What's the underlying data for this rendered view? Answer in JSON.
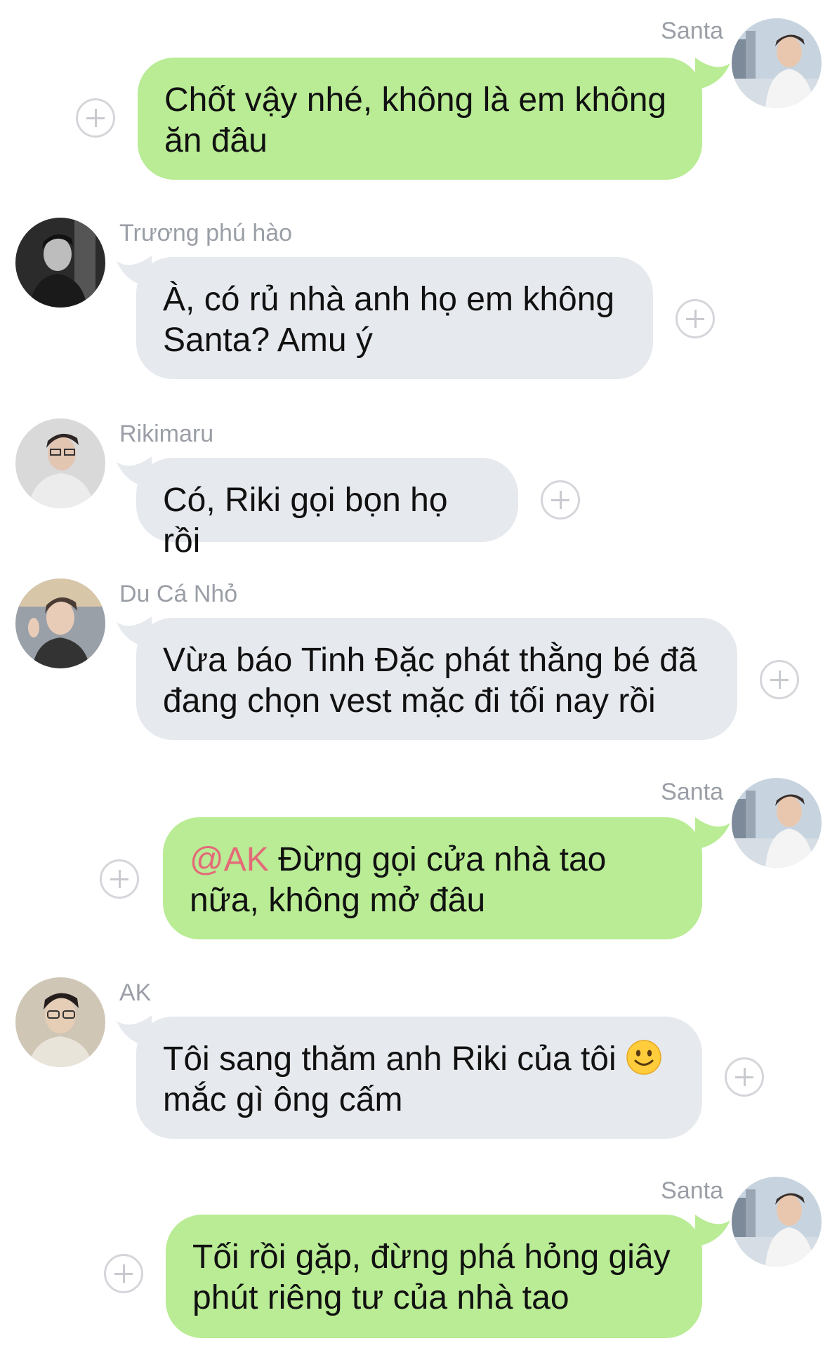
{
  "messages": [
    {
      "sender": "Santa",
      "text": "Chốt vậy nhé, không là em không ăn đâu"
    },
    {
      "sender": "Trương phú hào",
      "text": "À, có rủ nhà anh họ em không Santa? Amu ý"
    },
    {
      "sender": "Rikimaru",
      "text": "Có, Riki gọi bọn họ rồi"
    },
    {
      "sender": "Du Cá Nhỏ",
      "text": "Vừa báo Tinh Đặc phát thằng bé đã đang chọn vest mặc đi tối nay rồi"
    },
    {
      "sender": "Santa",
      "mention": "@AK",
      "text": " Đừng gọi cửa nhà tao nữa, không mở đâu"
    },
    {
      "sender": "AK",
      "text": "Tôi sang thăm anh Riki của tôi ",
      "text2": "mắc gì ông cấm",
      "emoji": "slightly-smiling-face-icon"
    },
    {
      "sender": "Santa",
      "text": "Tối rồi gặp, đừng phá hỏng giây phút riêng tư của nhà tao"
    }
  ],
  "colors": {
    "outgoing_bubble": "#b9ec95",
    "incoming_bubble": "#e6e9ed",
    "name_text": "#9a9ea6",
    "mention": "#e46a78"
  }
}
